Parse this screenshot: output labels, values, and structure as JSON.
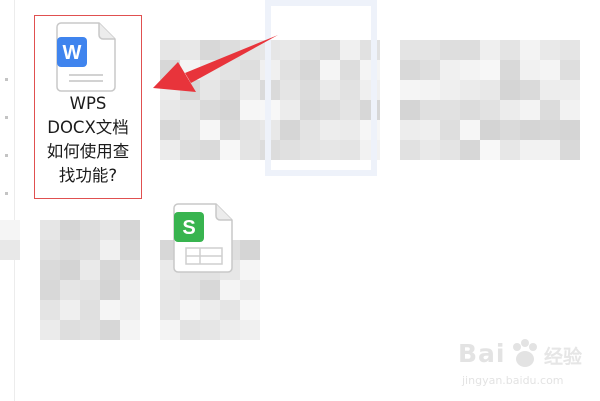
{
  "desktop": {
    "files": [
      {
        "name_lines": [
          "WPS",
          "DOCX文档",
          "如何使用查",
          "找功能?"
        ],
        "icon": "wps-writer-doc-icon",
        "icon_letter": "W",
        "icon_color": "#3f84ee",
        "selected": true
      },
      {
        "name_lines": [],
        "icon": "wps-spreadsheet-icon",
        "icon_letter": "S",
        "icon_color": "#38b44f",
        "selected": false
      }
    ],
    "selection_color": "#e05050",
    "annotation_arrow_color": "#e8343b"
  },
  "watermark": {
    "logo": "Bai",
    "logo_suffix": "经验",
    "url": "jingyan.baidu.com"
  }
}
